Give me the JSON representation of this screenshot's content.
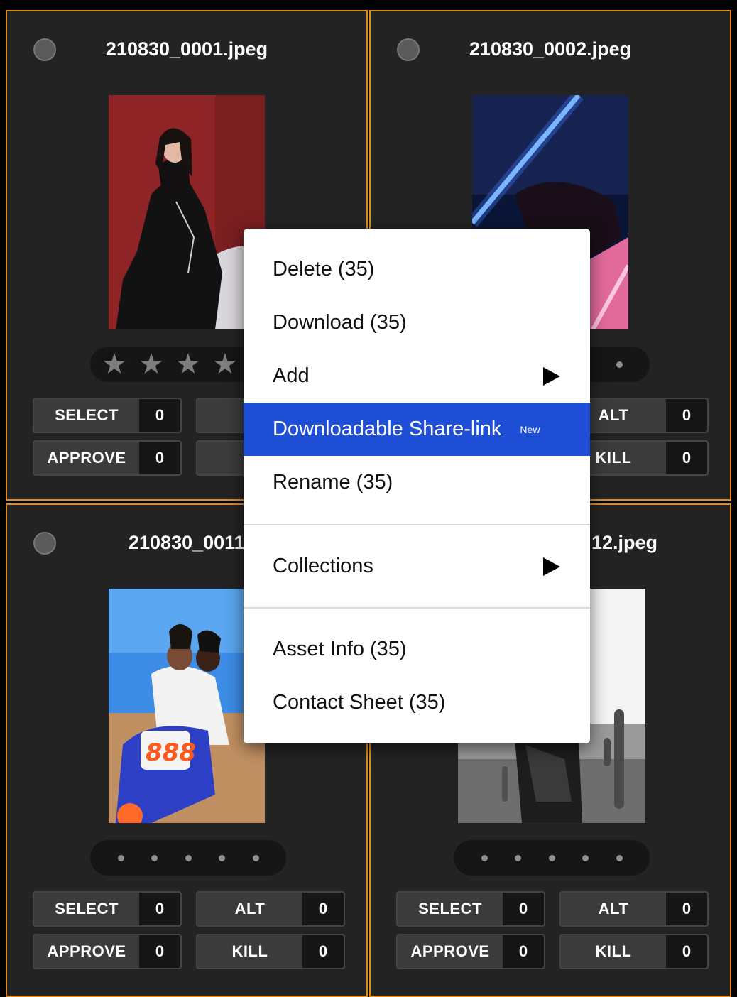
{
  "cards": [
    {
      "filename": "210830_0001.jpeg"
    },
    {
      "filename": "210830_0002.jpeg"
    },
    {
      "filename": "210830_0011"
    },
    {
      "filename": "12.jpeg"
    }
  ],
  "buttons": {
    "select": "SELECT",
    "approve": "APPROVE",
    "alt": "ALT",
    "kill": "KILL",
    "alt_partial": "A",
    "kill_partial": "K",
    "zero": "0"
  },
  "rating": {
    "star_glyph": "★",
    "filled": 0,
    "max": 5
  },
  "menu": {
    "delete": "Delete (35)",
    "download": "Download (35)",
    "add": "Add",
    "share": "Downloadable Share-link",
    "share_badge": "New",
    "rename": "Rename (35)",
    "collections": "Collections",
    "asset_info": "Asset Info (35)",
    "contact_sheet": "Contact Sheet (35)"
  },
  "colors": {
    "card_border": "#e58a1f",
    "card_bg": "#232323",
    "menu_highlight": "#1f4fd6"
  },
  "icons": [
    "star-icon",
    "submenu-arrow-icon",
    "selection-circle-icon"
  ]
}
